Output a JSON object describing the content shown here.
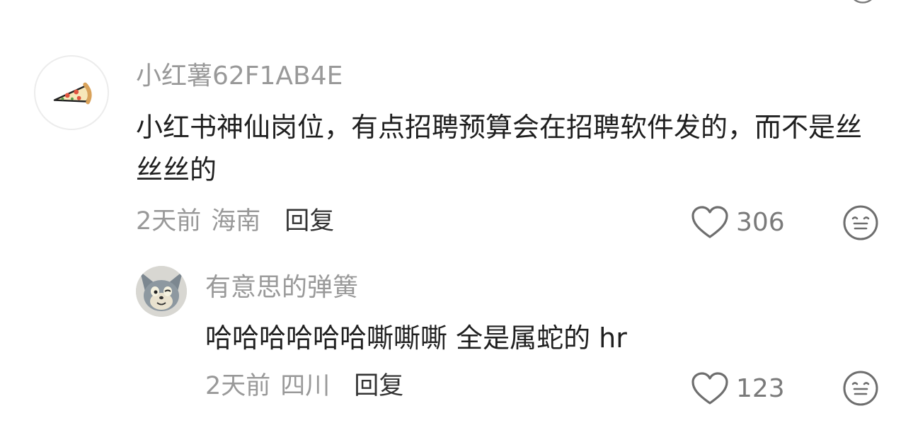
{
  "comment": {
    "username": "小红薯62F1AB4E",
    "avatar_icon": "pizza-icon",
    "text": "小红书神仙岗位，有点招聘预算会在招聘软件发的，而不是丝丝丝的",
    "time": "2天前",
    "location": "海南",
    "reply_label": "回复",
    "likes": "306",
    "like_icon": "heart-icon",
    "emoji_icon": "neutral-face-icon"
  },
  "reply": {
    "username": "有意思的弹簧",
    "avatar_icon": "cartoon-cat-avatar",
    "text": "哈哈哈哈哈哈嘶嘶嘶 全是属蛇的 hr",
    "time": "2天前",
    "location": "四川",
    "reply_label": "回复",
    "likes": "123",
    "like_icon": "heart-icon",
    "emoji_icon": "neutral-face-icon"
  },
  "colors": {
    "secondary_text": "#999999",
    "primary_text": "#1f1f1f",
    "icon_gray": "#7a7a7a"
  }
}
